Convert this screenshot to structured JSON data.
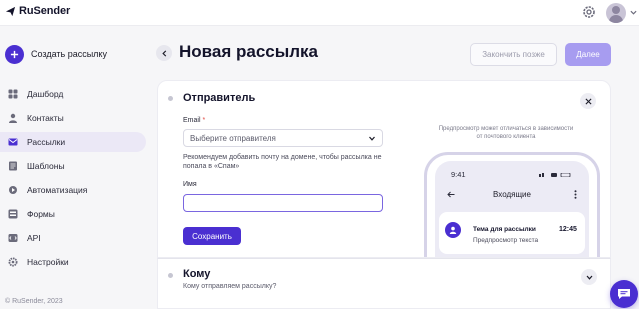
{
  "app": {
    "logo_text": "RuSender"
  },
  "colors": {
    "accent": "#4a2fd1",
    "accent_light": "#a79cf0",
    "active_nav_bg": "#ebe8f6",
    "required": "#e0463e"
  },
  "topbar": {
    "icons": [
      "settings-icon",
      "avatar",
      "chevron-down-icon"
    ]
  },
  "sidebar": {
    "create_label": "Создать рассылку",
    "items": [
      {
        "label": "Дашборд",
        "icon": "dashboard-icon",
        "active": false
      },
      {
        "label": "Контакты",
        "icon": "contacts-icon",
        "active": false
      },
      {
        "label": "Рассылки",
        "icon": "mailings-icon",
        "active": true
      },
      {
        "label": "Шаблоны",
        "icon": "templates-icon",
        "active": false
      },
      {
        "label": "Автоматизация",
        "icon": "automation-icon",
        "active": false
      },
      {
        "label": "Формы",
        "icon": "forms-icon",
        "active": false
      },
      {
        "label": "API",
        "icon": "api-icon",
        "active": false
      },
      {
        "label": "Настройки",
        "icon": "settings-icon",
        "active": false
      }
    ],
    "copyright": "© RuSender, 2023"
  },
  "header": {
    "title": "Новая рассылка",
    "later_label": "Закончить позже",
    "next_label": "Далее"
  },
  "sender": {
    "title": "Отправитель",
    "email_label": "Email",
    "required_mark": "*",
    "email_placeholder": "Выберите отправителя",
    "hint": "Рекомендуем добавить почту на домене, чтобы рассылка не попала в «Спам»",
    "name_label": "Имя",
    "name_value": "",
    "save_label": "Сохранить",
    "preview_note": "Предпросмотр может отличаться в зависимости от почтового клиента",
    "phone": {
      "time": "9:41",
      "inbox_title": "Входящие",
      "subject": "Тема для рассылки",
      "preview": "Предпросмотр текста",
      "msg_time": "12:45"
    }
  },
  "recipients": {
    "title": "Кому",
    "subtitle": "Кому отправляем рассылку?"
  }
}
